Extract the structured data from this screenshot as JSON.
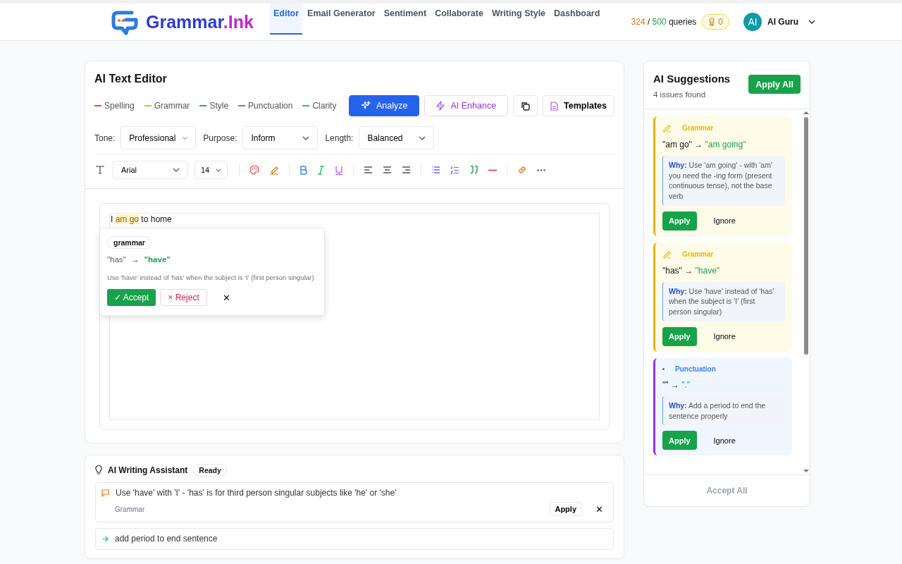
{
  "brand": {
    "name": "Grammar",
    "suffix": ".Ink"
  },
  "nav": [
    {
      "label": "Editor",
      "selected": true
    },
    {
      "label": "Email Generator",
      "selected": false
    },
    {
      "label": "Sentiment",
      "selected": false
    },
    {
      "label": "Collaborate",
      "selected": false
    },
    {
      "label": "Writing Style",
      "selected": false
    },
    {
      "label": "Dashboard",
      "selected": false
    }
  ],
  "usage": {
    "used": "324",
    "sep": "/",
    "limit": "500",
    "unit": "queries"
  },
  "badge_count": "0",
  "user": {
    "initials": "AI",
    "name": "AI Guru"
  },
  "editor": {
    "title": "AI Text Editor",
    "legend": [
      {
        "label": "Spelling",
        "color": "#ef4444"
      },
      {
        "label": "Grammar",
        "color": "#eab308"
      },
      {
        "label": "Style",
        "color": "#3b82f6"
      },
      {
        "label": "Punctuation",
        "color": "#a855f7"
      },
      {
        "label": "Clarity",
        "color": "#22c55e"
      }
    ],
    "analyze": "Analyze",
    "enhance": "AI Enhance",
    "templates": "Templates",
    "selects": [
      {
        "label": "Tone:",
        "value": "Professional"
      },
      {
        "label": "Purpose:",
        "value": "Inform"
      },
      {
        "label": "Length:",
        "value": "Balanced"
      }
    ],
    "font": "Arial",
    "size": "14",
    "text": {
      "before": "I",
      "marked": "am go",
      "after": "to home"
    },
    "popup": {
      "tag": "grammar",
      "from": "\"has\"",
      "arrow": "→",
      "to": "\"have\"",
      "note": "Use 'have' instead of 'has' when the subject is 'I' (first person singular)",
      "accept": "✓ Accept",
      "reject": "× Reject",
      "close": "✕"
    }
  },
  "assistant": {
    "title": "AI Writing Assistant",
    "status": "Ready",
    "items": [
      {
        "kind": "comment",
        "text": "Use 'have' with 'I' - 'has' is for third person singular subjects like 'he' or 'she'",
        "category": "Grammar",
        "apply": "Apply",
        "close": "✕"
      },
      {
        "kind": "arrow",
        "text": "add period to end sentence"
      }
    ]
  },
  "suggestions": {
    "title": "AI Suggestions",
    "count": "4 issues found",
    "apply_all": "Apply All",
    "items": [
      {
        "kind": "grammar",
        "category": "Grammar",
        "from": "\"am go\"",
        "arrow": "→",
        "to": "\"am going\"",
        "why": "Why:",
        "reason": "Use 'am going' - with 'am' you need the -ing form (present continuous tense), not the base verb",
        "apply": "Apply",
        "ignore": "Ignore"
      },
      {
        "kind": "grammar",
        "category": "Grammar",
        "from": "\"has\"",
        "arrow": "→",
        "to": "\"have\"",
        "why": "Why:",
        "reason": "Use 'have' instead of 'has' when the subject is 'I' (first person singular)",
        "apply": "Apply",
        "ignore": "Ignore"
      },
      {
        "kind": "punctuation",
        "category": "Punctuation",
        "from": "\"\"",
        "arrow": "→",
        "to": "\".\"",
        "why": "Why:",
        "reason": "Add a period to end the sentence properly",
        "apply": "Apply",
        "ignore": "Ignore"
      }
    ],
    "accept_all": {
      "label": "Accept All",
      "disabled": true
    }
  }
}
